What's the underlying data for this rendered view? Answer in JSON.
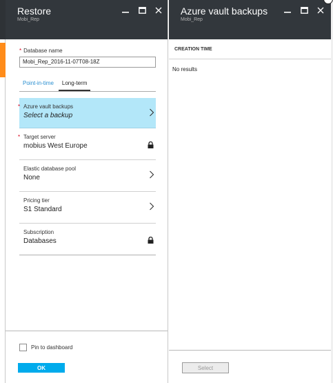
{
  "blade_restore": {
    "title": "Restore",
    "subtitle": "Mobi_Rep",
    "database_name_label": "Database name",
    "database_name_value": "Mobi_Rep_2016-11-07T08-18Z",
    "tabs": [
      {
        "label": "Point-in-time"
      },
      {
        "label": "Long-term"
      }
    ],
    "rows": [
      {
        "label": "Azure vault backups",
        "value": "Select a backup"
      },
      {
        "label": "Target server",
        "value": "mobius West Europe"
      },
      {
        "label": "Elastic database pool",
        "value": "None"
      },
      {
        "label": "Pricing tier",
        "value": "S1 Standard"
      },
      {
        "label": "Subscription",
        "value": "Databases"
      }
    ],
    "pin_label": "Pin to dashboard",
    "ok_label": "OK"
  },
  "blade_vault": {
    "title": "Azure vault backups",
    "subtitle": "Mobi_Rep",
    "column_header": "CREATION TIME",
    "empty_text": "No results",
    "select_label": "Select"
  },
  "colors": {
    "header_bg": "#32373c",
    "accent": "#00abec",
    "selected_row": "#b3e7f9",
    "required": "#d8001a",
    "tab_active_link": "#2a8fd0"
  }
}
